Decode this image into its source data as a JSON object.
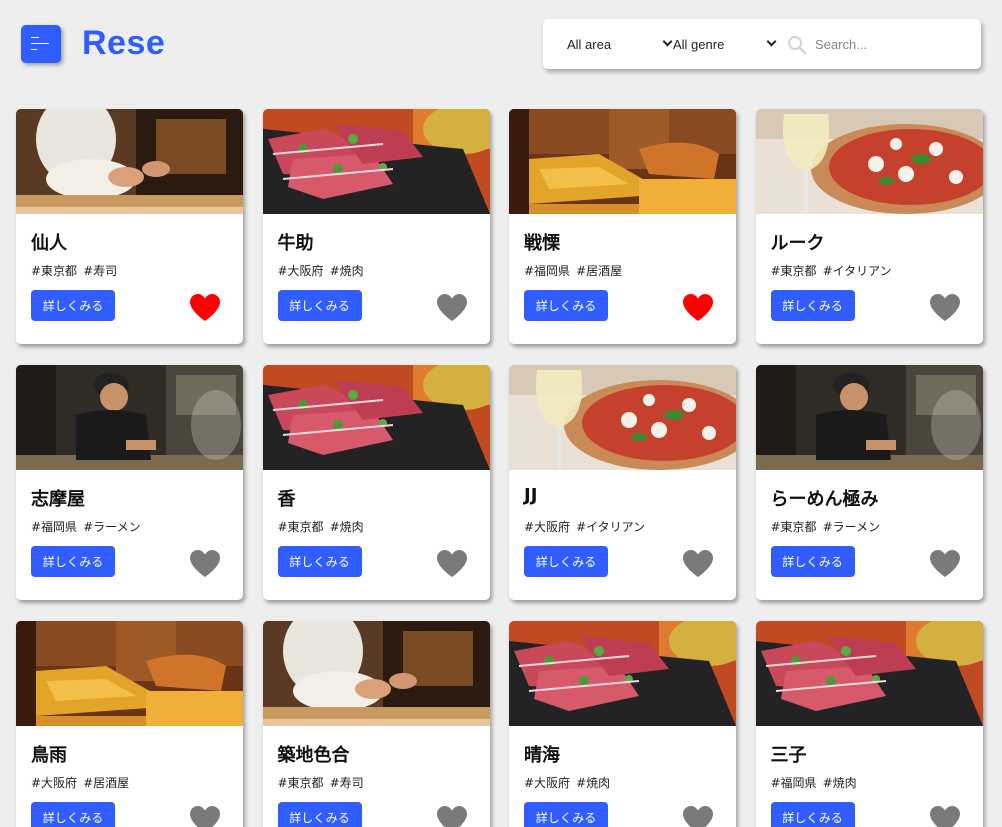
{
  "header": {
    "logo": "Rese",
    "area_select": "All area",
    "genre_select": "All genre",
    "search_placeholder": "Search..."
  },
  "colors": {
    "accent": "#305DFF",
    "favorite_on": "#FF0000",
    "favorite_off": "#7A7A7A"
  },
  "shops": [
    {
      "name": "仙人",
      "area": "#東京都",
      "genre": "#寿司",
      "detail": "詳しくみる",
      "favorite": true,
      "image": "sushi-chef"
    },
    {
      "name": "牛助",
      "area": "#大阪府",
      "genre": "#焼肉",
      "detail": "詳しくみる",
      "favorite": false,
      "image": "yakiniku-meat"
    },
    {
      "name": "戦慄",
      "area": "#福岡県",
      "genre": "#居酒屋",
      "detail": "詳しくみる",
      "favorite": true,
      "image": "izakaya-interior"
    },
    {
      "name": "ルーク",
      "area": "#東京都",
      "genre": "#イタリアン",
      "detail": "詳しくみる",
      "favorite": false,
      "image": "pizza-wine"
    },
    {
      "name": "志摩屋",
      "area": "#福岡県",
      "genre": "#ラーメン",
      "detail": "詳しくみる",
      "favorite": false,
      "image": "ramen-cook"
    },
    {
      "name": "香",
      "area": "#東京都",
      "genre": "#焼肉",
      "detail": "詳しくみる",
      "favorite": false,
      "image": "yakiniku-meat"
    },
    {
      "name": "JJ",
      "area": "#大阪府",
      "genre": "#イタリアン",
      "detail": "詳しくみる",
      "favorite": false,
      "image": "pizza-wine"
    },
    {
      "name": "らーめん極み",
      "area": "#東京都",
      "genre": "#ラーメン",
      "detail": "詳しくみる",
      "favorite": false,
      "image": "ramen-cook"
    },
    {
      "name": "鳥雨",
      "area": "#大阪府",
      "genre": "#居酒屋",
      "detail": "詳しくみる",
      "favorite": false,
      "image": "izakaya-interior"
    },
    {
      "name": "築地色合",
      "area": "#東京都",
      "genre": "#寿司",
      "detail": "詳しくみる",
      "favorite": false,
      "image": "sushi-chef"
    },
    {
      "name": "晴海",
      "area": "#大阪府",
      "genre": "#焼肉",
      "detail": "詳しくみる",
      "favorite": false,
      "image": "yakiniku-meat"
    },
    {
      "name": "三子",
      "area": "#福岡県",
      "genre": "#焼肉",
      "detail": "詳しくみる",
      "favorite": false,
      "image": "yakiniku-meat"
    }
  ]
}
